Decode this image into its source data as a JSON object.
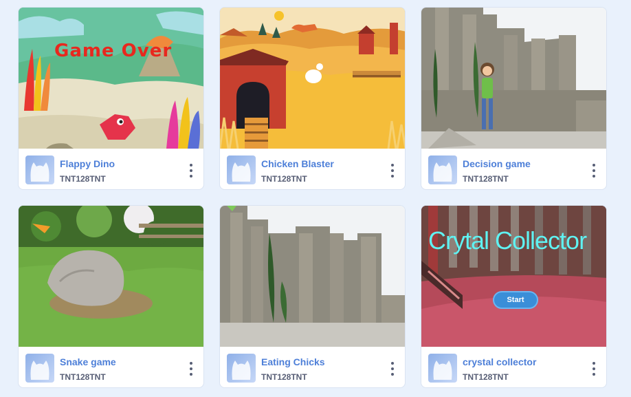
{
  "projects": [
    {
      "title": "Flappy Dino",
      "author": "TNT128TNT",
      "thumb_text": "Game Over"
    },
    {
      "title": "Chicken Blaster",
      "author": "TNT128TNT"
    },
    {
      "title": "Decision game",
      "author": "TNT128TNT"
    },
    {
      "title": "Snake game",
      "author": "TNT128TNT"
    },
    {
      "title": "Eating Chicks",
      "author": "TNT128TNT"
    },
    {
      "title": "crystal collector",
      "author": "TNT128TNT",
      "thumb_text": "Crytal Collector",
      "thumb_button": "Start"
    }
  ],
  "colors": {
    "page_bg": "#e9f1fc",
    "title": "#4d7fd8",
    "author": "#575e75"
  }
}
